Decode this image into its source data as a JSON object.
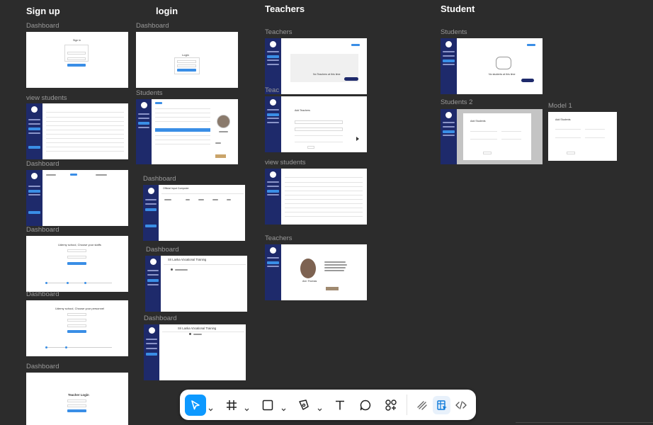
{
  "sections": {
    "signup": "Sign up",
    "login": "login",
    "teachers": "Teachers",
    "student": "Student"
  },
  "frame_labels": {
    "su_dashboard": "Dashboard",
    "su_view_students": "view students",
    "su_dashboard_2": "Dashboard",
    "su_dashboard_3": "Dashboard",
    "su_dashboard_4": "Dashboard",
    "su_dashboard_5": "Dashboard",
    "lg_dashboard": "Dashboard",
    "lg_students": "Students",
    "lg_dashboard_2": "Dashboard",
    "lg_dashboard_3": "Dashboard",
    "lg_dashboard_4": "Dashboard",
    "t_teachers": "Teachers",
    "t_teac": "Teac",
    "t_view_students": "view students",
    "t_teachers_2": "Teachers",
    "s_students": "Students",
    "s_students_2": "Students 2",
    "s_model_1": "Model 1"
  },
  "frame_text": {
    "sign_in": "Sign in",
    "login": "Login",
    "unity_staff": "Udemy school, Choose your staffs",
    "unity_personnel": "Udemy school, Choose your personnel",
    "teacher_login": "Teacher Login",
    "no_teachers": "No Teachers at this time",
    "no_students": "No students at this time",
    "add_teachers": "Add Teachers",
    "add_students": "Add Students",
    "official_enquiries": "Official Input Computer",
    "sri_lanka_vt": "Sri Lanka Vocational Training",
    "sri_lanka_vt_2": "Sri Lanka Vocational Training",
    "teacher_profile_name": "Ann Thomas"
  },
  "toolbar": {
    "tools": [
      {
        "name": "move-tool",
        "active": true
      },
      {
        "name": "frame-tool",
        "active": false
      },
      {
        "name": "rectangle-tool",
        "active": false
      },
      {
        "name": "pen-tool",
        "active": false
      },
      {
        "name": "text-tool",
        "active": false
      },
      {
        "name": "comment-tool",
        "active": false
      },
      {
        "name": "actions-tool",
        "active": false
      },
      {
        "name": "draw-tool",
        "active": false
      },
      {
        "name": "design-mode",
        "active": true
      },
      {
        "name": "dev-mode",
        "active": false
      }
    ]
  },
  "colors": {
    "canvas": "#2c2c2c",
    "sidebar": "#1e2a6b",
    "accent": "#3a8ee6",
    "toolbar_active": "#0d99ff"
  }
}
